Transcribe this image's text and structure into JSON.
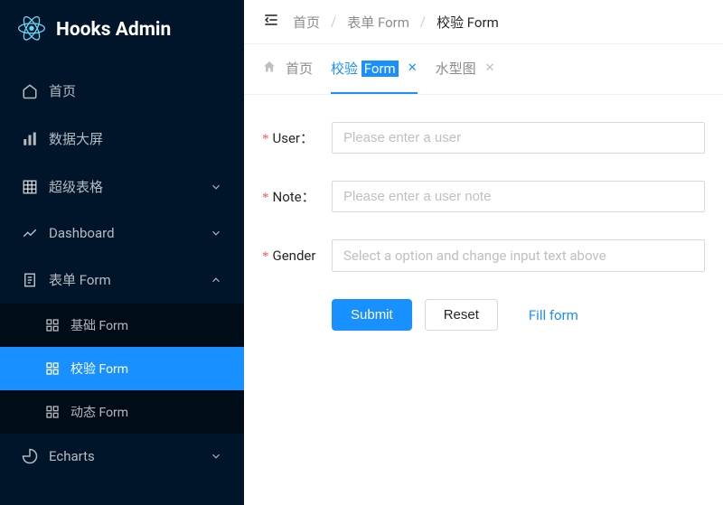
{
  "brand": "Hooks Admin",
  "sidebar": {
    "items": [
      {
        "label": "首页",
        "icon": "home"
      },
      {
        "label": "数据大屏",
        "icon": "bar-chart"
      },
      {
        "label": "超级表格",
        "icon": "grid",
        "expandable": true
      },
      {
        "label": "Dashboard",
        "icon": "line-chart",
        "expandable": true
      },
      {
        "label": "表单 Form",
        "icon": "document",
        "expandable": true,
        "expanded": true,
        "children": [
          {
            "label": "基础 Form"
          },
          {
            "label": "校验 Form",
            "active": true
          },
          {
            "label": "动态 Form"
          }
        ]
      },
      {
        "label": "Echarts",
        "icon": "pie"
      }
    ]
  },
  "breadcrumb": {
    "items": [
      "首页",
      "表单 Form",
      "校验 Form"
    ]
  },
  "tabs": [
    {
      "label": "首页",
      "icon": "home",
      "closable": false
    },
    {
      "label_pre": "校验 ",
      "label_hl": "Form",
      "active": true,
      "closable": true
    },
    {
      "label": "水型图",
      "closable": true
    }
  ],
  "form": {
    "fields": [
      {
        "label": "User",
        "colon": "：",
        "placeholder": "Please enter a user",
        "type": "text"
      },
      {
        "label": "Note",
        "colon": "：",
        "placeholder": "Please enter a user note",
        "type": "text"
      },
      {
        "label": "Gender",
        "colon": "",
        "placeholder": "Select a option and change input text above",
        "type": "select"
      }
    ],
    "actions": {
      "submit": "Submit",
      "reset": "Reset",
      "fill": "Fill form"
    }
  }
}
